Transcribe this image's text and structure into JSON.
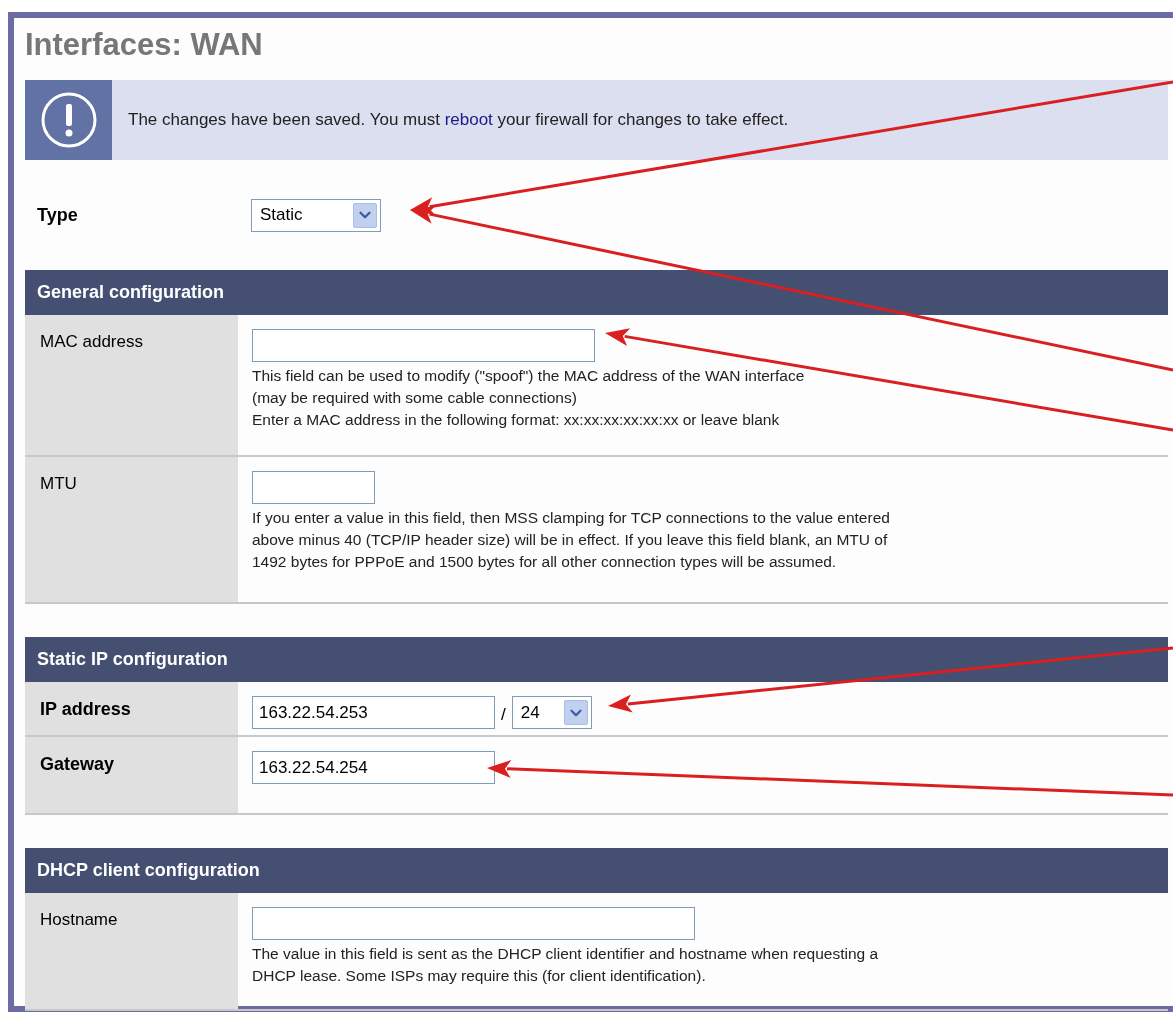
{
  "title": "Interfaces: WAN",
  "notice": {
    "before": "The changes have been saved. You must ",
    "link": "reboot",
    "after": " your firewall for changes to take effect."
  },
  "type": {
    "label": "Type",
    "value": "Static"
  },
  "sections": [
    {
      "title": "General configuration",
      "rows": [
        {
          "label": "MAC address",
          "bold": false,
          "fields": [
            {
              "kind": "input"
            }
          ],
          "help": [
            "This field can be used to modify (\"spoof\") the MAC address of the WAN interface",
            "(may be required with some cable connections)",
            "Enter a MAC address in the following format: xx:xx:xx:xx:xx:xx or leave blank"
          ]
        },
        {
          "label": "MTU",
          "bold": false,
          "fields": [
            {
              "kind": "input"
            }
          ],
          "help": [
            "If you enter a value in this field, then MSS clamping for TCP connections to the value entered",
            "above minus 40 (TCP/IP header size) will be in effect. If you leave this field blank, an MTU of",
            "1492 bytes for PPPoE and 1500 bytes for all other connection types will be assumed."
          ]
        }
      ]
    },
    {
      "title": "Static IP configuration",
      "rows": [
        {
          "label": "IP address",
          "bold": true,
          "fields": [
            {
              "kind": "input",
              "value": "163.22.54.253"
            },
            {
              "kind": "separator",
              "value": "/"
            },
            {
              "kind": "select",
              "value": "24"
            }
          ]
        },
        {
          "label": "Gateway",
          "bold": true,
          "fields": [
            {
              "kind": "input",
              "value": "163.22.54.254"
            }
          ]
        }
      ]
    },
    {
      "title": "DHCP client configuration",
      "rows": [
        {
          "label": "Hostname",
          "bold": false,
          "fields": [
            {
              "kind": "input"
            }
          ],
          "help": [
            "The value in this field is sent as the DHCP client identifier and hostname when requesting a",
            "DHCP lease. Some ISPs may require this (for client identification)."
          ]
        }
      ]
    }
  ]
}
